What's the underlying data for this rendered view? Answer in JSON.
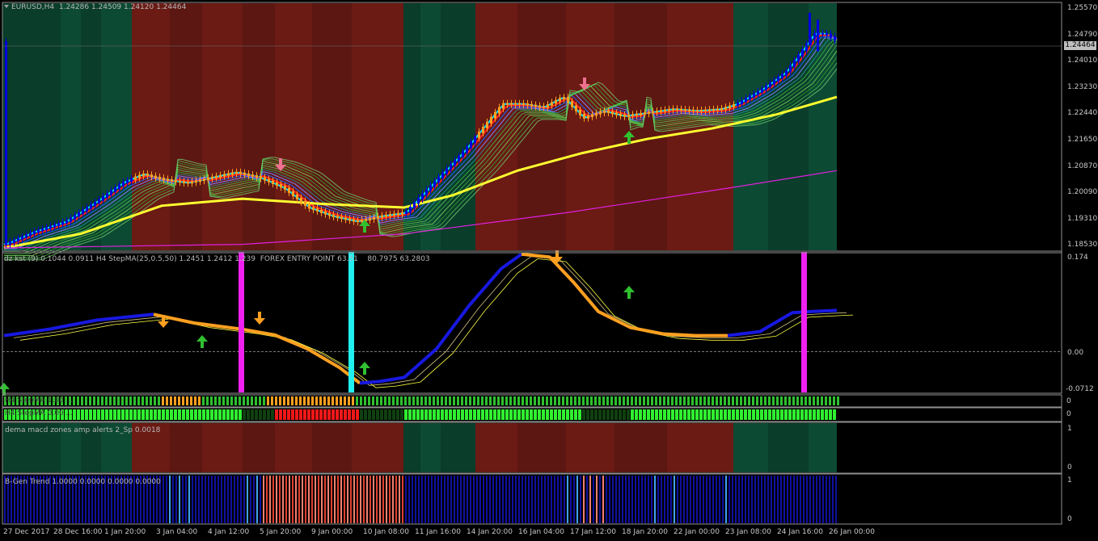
{
  "main_panel": {
    "symbol": "EURUSD,H4",
    "ohlc": "1.24286 1.24509 1.24120 1.24464",
    "current_price": "1.24464",
    "price_axis": [
      "1.25570",
      "1.24790",
      "1.24010",
      "1.23230",
      "1.22440",
      "1.21650",
      "1.20870",
      "1.20090",
      "1.19310",
      "1.18530"
    ],
    "colors": {
      "bull_zone": "#0a3d2a",
      "bear_zone": "#6b1a14",
      "up_candle": "#0000e0",
      "down_candle": "#ffa020"
    }
  },
  "kst_panel": {
    "label": "dz kst (9) 0.1044 0.0911  H4 StepMA(25,0.5,50) 1.2451 1.2412 1.239",
    "label2": "FOREX ENTRY POINT 63.51",
    "label3": "80.7975 63.2803",
    "axis": [
      "0.174",
      "0.00",
      "-0.0712"
    ]
  },
  "strip1": {
    "label": "H4 StepMA 1.00 ...",
    "axis": "0"
  },
  "strip2": {
    "label": "H4 StepMA 0.00 ...",
    "axis": "0"
  },
  "macd_panel": {
    "label": "dema macd zones amp alerts 2_Sp 0.0018",
    "axis": [
      "1",
      "0"
    ]
  },
  "bgen_panel": {
    "label": "B-Gen Trend 1.0000 0.0000 0.0000 0.0000",
    "axis": [
      "1",
      "0"
    ]
  },
  "time_axis": [
    "27 Dec 2017",
    "28 Dec 16:00",
    "1 Jan 20:00",
    "3 Jan 04:00",
    "4 Jan 12:00",
    "5 Jan 20:00",
    "9 Jan 00:00",
    "10 Jan 08:00",
    "11 Jan 16:00",
    "14 Jan 20:00",
    "16 Jan 04:00",
    "17 Jan 12:00",
    "18 Jan 20:00",
    "22 Jan 00:00",
    "23 Jan 08:00",
    "24 Jan 16:00",
    "26 Jan 00:00"
  ]
}
